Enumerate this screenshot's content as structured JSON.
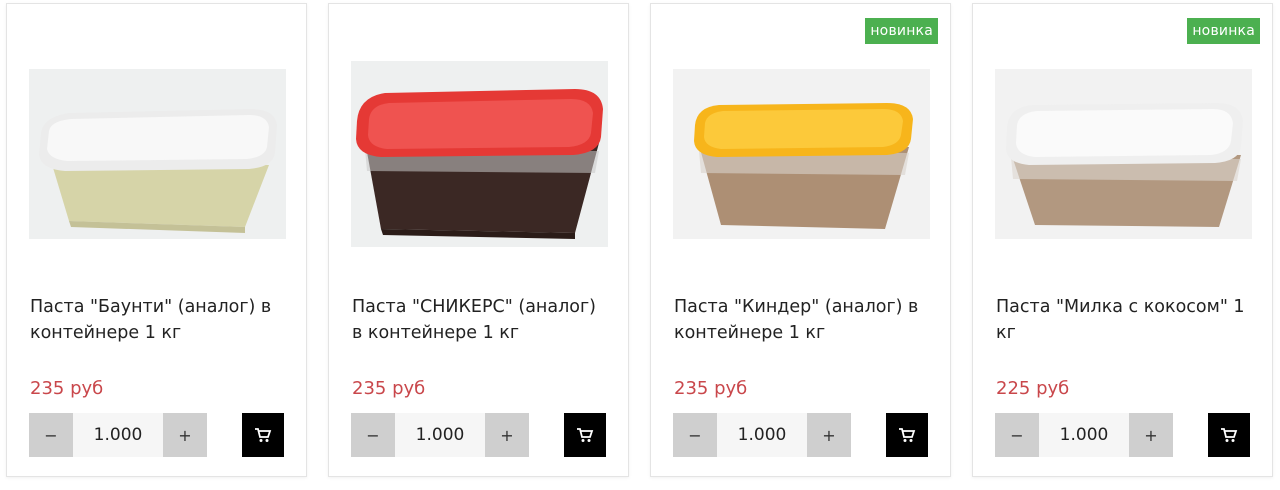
{
  "products": [
    {
      "title": "Паста \"Баунти\" (аналог) в контейнере 1 кг",
      "price": "235 руб",
      "quantity": "1.000",
      "badge": "",
      "lid_color": "#ececec",
      "content_color": "#d6d4a8"
    },
    {
      "title": "Паста \"СНИКЕРС\" (аналог) в контейнере 1 кг",
      "price": "235 руб",
      "quantity": "1.000",
      "badge": "",
      "lid_color": "#e53935",
      "content_color": "#3b2824"
    },
    {
      "title": "Паста \"Киндер\" (аналог) в контейнере 1 кг",
      "price": "235 руб",
      "quantity": "1.000",
      "badge": "новинка",
      "lid_color": "#f7b51b",
      "content_color": "#ad8f74"
    },
    {
      "title": "Паста \"Милка с кокосом\" 1 кг",
      "price": "225 руб",
      "quantity": "1.000",
      "badge": "новинка",
      "lid_color": "#efefef",
      "content_color": "#b29880"
    }
  ],
  "controls": {
    "minus": "−",
    "plus": "+"
  },
  "colors": {
    "price": "#c9474b",
    "badge": "#4cb050",
    "cart_button": "#000000",
    "stepper": "#cfcfcf"
  },
  "icons": {
    "cart": "shopping-cart-icon"
  }
}
